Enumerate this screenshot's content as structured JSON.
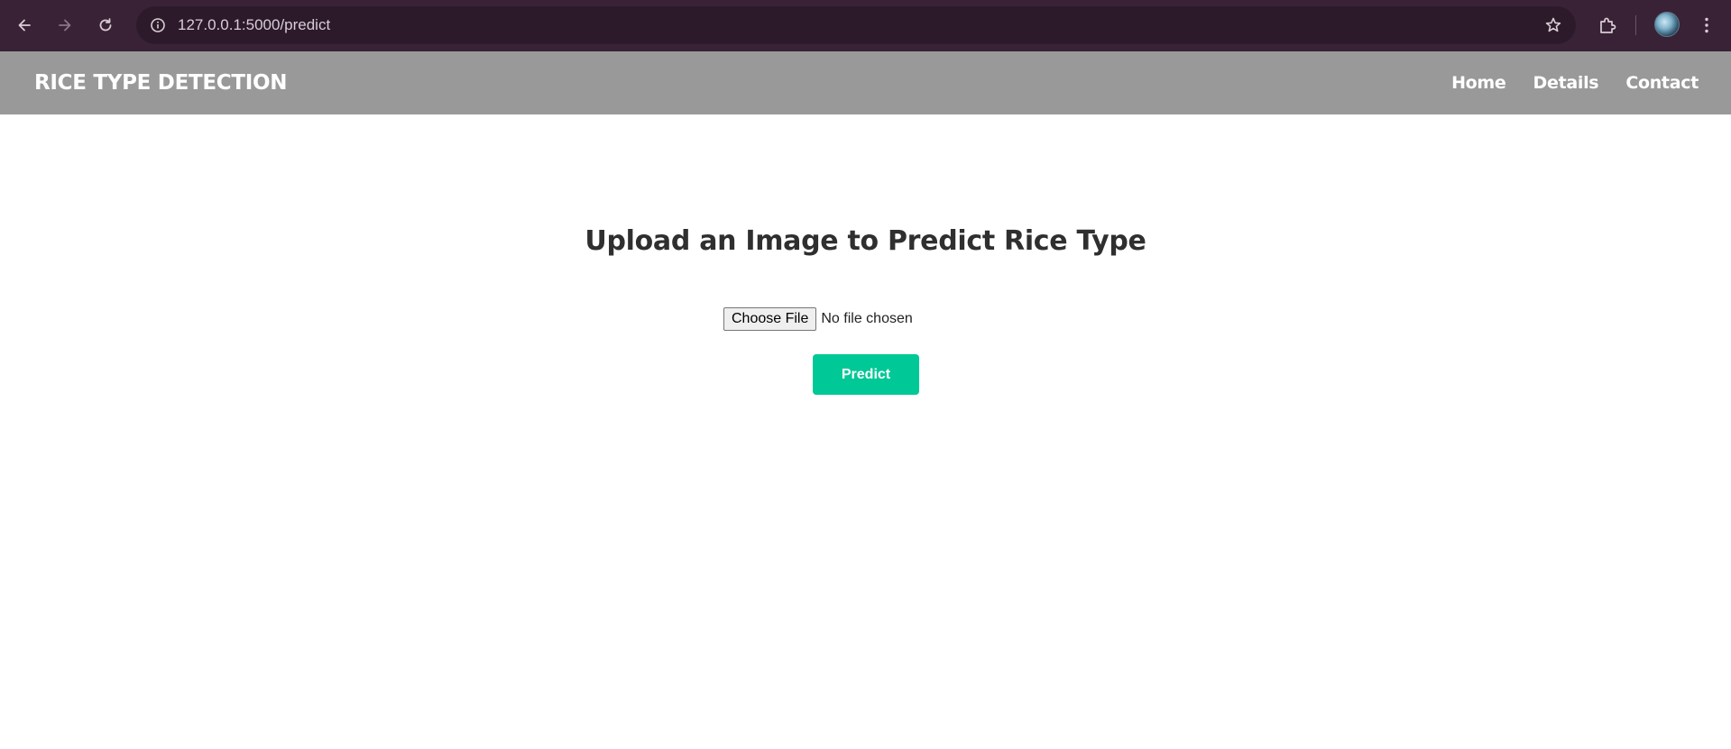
{
  "browser": {
    "url": "127.0.0.1:5000/predict",
    "back_icon": "arrow-left-icon",
    "forward_icon": "arrow-right-icon",
    "reload_icon": "reload-icon",
    "site_info_icon": "info-icon",
    "bookmark_icon": "star-icon",
    "extensions_icon": "puzzle-icon",
    "menu_icon": "kebab-menu-icon",
    "colors": {
      "toolbar": "#3a2236",
      "omnibox": "#2c1a2a"
    }
  },
  "navbar": {
    "brand": "RICE TYPE DETECTION",
    "links": [
      "Home",
      "Details",
      "Contact"
    ],
    "background": "#999999"
  },
  "main": {
    "title": "Upload an Image to Predict Rice Type",
    "file_input": {
      "button_label": "Choose File",
      "status": "No file chosen"
    },
    "predict_button": "Predict",
    "accent_color": "#00c896"
  }
}
